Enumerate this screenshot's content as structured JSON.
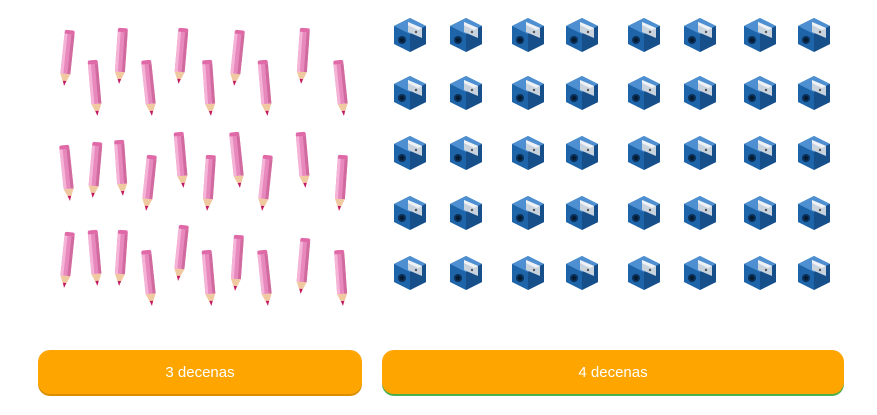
{
  "pencils": {
    "icon": "pencil-icon",
    "color": "#E889BE",
    "count": 30
  },
  "sharpeners": {
    "icon": "sharpener-icon",
    "color": "#1E64A8",
    "count": 40
  },
  "options": [
    {
      "label": "3 decenas"
    },
    {
      "label": "4 decenas"
    }
  ],
  "colors": {
    "button": "#FFA500",
    "button_text": "#FFFFFF"
  }
}
